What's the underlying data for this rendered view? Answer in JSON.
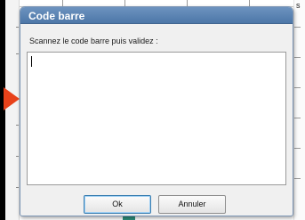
{
  "dialog": {
    "title": "Code barre",
    "prompt": "Scannez le code barre puis validez :",
    "barcode_value": "",
    "ok_label": "Ok",
    "cancel_label": "Annuler"
  },
  "background": {
    "right_edge_letter": "s"
  },
  "colors": {
    "titlebar": "#5a82b2",
    "dialog_body": "#f0f0f0",
    "arrow_marker": "#e8421a",
    "ok_focus_border": "#3c7fb1"
  }
}
